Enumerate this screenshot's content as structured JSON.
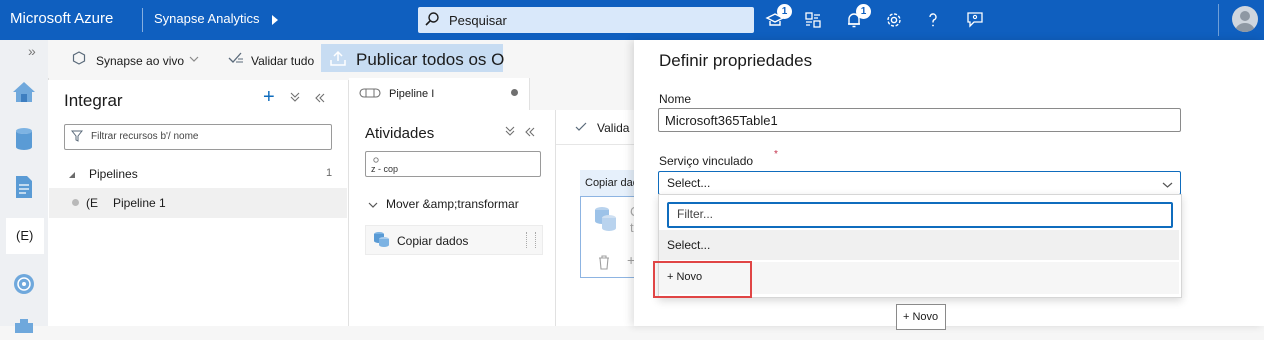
{
  "topbar": {
    "brand": "Microsoft Azure",
    "product": "Synapse Analytics",
    "search_placeholder": "Pesquisar",
    "notif_badge_1": "1",
    "notif_badge_2": "1",
    "icons": [
      "cloud-shell-icon",
      "directory-icon",
      "bell-icon",
      "gear-icon",
      "help-icon",
      "feedback-icon"
    ],
    "color": "#0f5fbf"
  },
  "toolbar": {
    "live_mode": "Synapse ao vivo",
    "validate_all": "Validar tudo",
    "publish_all": "Publicar todos os O"
  },
  "rail": {
    "collapse": "»",
    "items": [
      "home-icon",
      "data-icon",
      "develop-icon",
      "integrate-icon",
      "monitor-icon",
      "manage-icon"
    ],
    "integrate_label": "(E)"
  },
  "integrate": {
    "title": "Integrar",
    "filter_placeholder": "Filtrar recursos b'/ nome",
    "group_label": "Pipelines",
    "group_count": "1",
    "pipeline_prefix": "(E",
    "pipeline_name": "Pipeline 1"
  },
  "tab": {
    "label": "Pipeline I"
  },
  "activities": {
    "title": "Atividades",
    "search_value": "z - cop",
    "category": "Mover &amp;transformar",
    "item": "Copiar dados"
  },
  "canvas": {
    "validate": "Valida",
    "node_title": "Copiar dados",
    "node_letters": [
      "C",
      "t"
    ]
  },
  "properties": {
    "title": "Definir propriedades",
    "name_label": "Nome",
    "name_value": "Microsoft365Table1",
    "linked_service_label": "Serviço vinculado",
    "required_mark": "*",
    "select_value": "Select...",
    "filter_placeholder": "Filter...",
    "option_select": "Select...",
    "option_new": "+ Novo",
    "new_button": "+ Novo",
    "highlight_color": "#e04545",
    "accent": "#0f6cbd"
  }
}
